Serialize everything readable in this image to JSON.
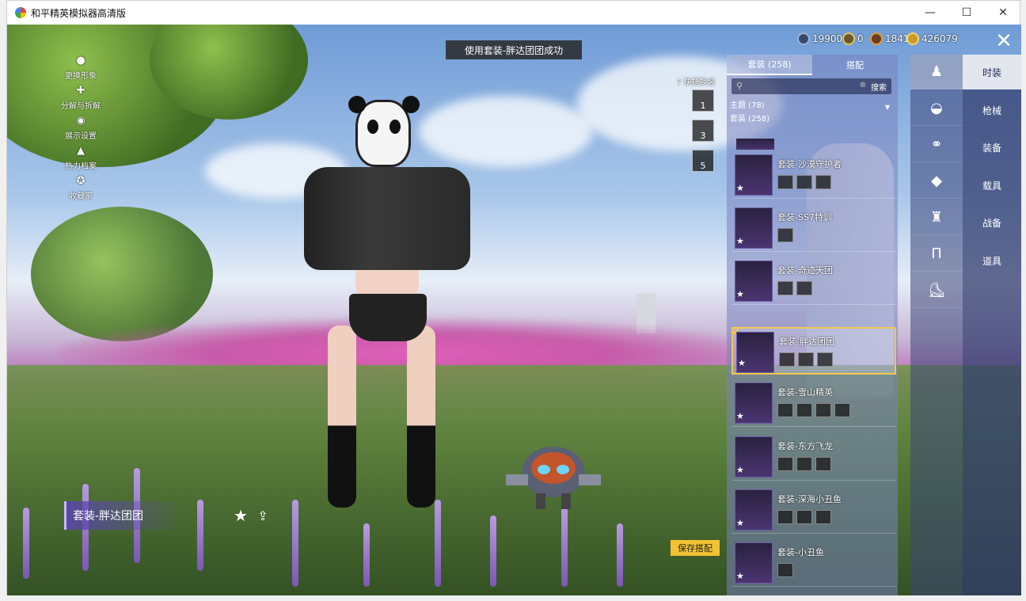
{
  "window": {
    "title": "和平精英模拟器高清版",
    "minimize": "—",
    "maximize": "☐",
    "close": "✕"
  },
  "toast": "使用套装-胖达团团成功",
  "currencies": [
    {
      "value": "19900"
    },
    {
      "value": "0"
    },
    {
      "value": "1841"
    },
    {
      "value": "426079"
    }
  ],
  "close_game": "✕",
  "left_menu": [
    {
      "label": "更换形象",
      "icon": "person-icon"
    },
    {
      "label": "分解与拆解",
      "icon": "puzzle-icon"
    },
    {
      "label": "展示设置",
      "icon": "eye-icon"
    },
    {
      "label": "热力档案",
      "icon": "fire-icon"
    },
    {
      "label": "收藏家",
      "icon": "medal-icon"
    }
  ],
  "quick_swap": {
    "label": "快捷换装",
    "slots": [
      "1",
      "3",
      "5"
    ]
  },
  "panel": {
    "tabs": [
      "套装 (258)",
      "搭配"
    ],
    "search_button": "搜索",
    "filter_theme": "主题 (78)",
    "filter_set": "套装 (258)",
    "outfits": [
      {
        "name": "套装-沙漠守护者",
        "chips": 3,
        "selected": false
      },
      {
        "name": "套装-SS7特训",
        "chips": 1,
        "selected": false
      },
      {
        "name": "套装-奇迹天团",
        "chips": 2,
        "selected": false
      },
      {
        "name": "套装-胖达团团",
        "chips": 3,
        "selected": true
      },
      {
        "name": "套装-雪山精英",
        "chips": 4,
        "selected": false
      },
      {
        "name": "套装-东方飞龙",
        "chips": 3,
        "selected": false
      },
      {
        "name": "套装-深海小丑鱼",
        "chips": 3,
        "selected": false
      },
      {
        "name": "套装-小丑鱼",
        "chips": 1,
        "selected": false
      }
    ]
  },
  "categories": [
    "outfit-icon",
    "hat-icon",
    "glasses-icon",
    "mask-icon",
    "top-icon",
    "pants-icon",
    "shoes-icon"
  ],
  "right_nav": [
    "时装",
    "枪械",
    "装备",
    "载具",
    "战备",
    "道具"
  ],
  "current_outfit": "套装-胖达团团",
  "save_button": "保存搭配"
}
